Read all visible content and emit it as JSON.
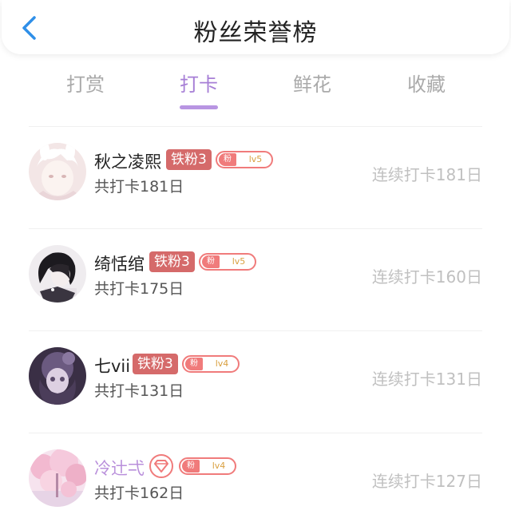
{
  "header": {
    "title": "粉丝荣誉榜",
    "back_icon": "chevron-left-icon"
  },
  "tabs": [
    {
      "label": "打赏",
      "active": false
    },
    {
      "label": "打卡",
      "active": true
    },
    {
      "label": "鲜花",
      "active": false
    },
    {
      "label": "收藏",
      "active": false
    }
  ],
  "colors": {
    "accent": "#a77fd6",
    "iron_tag": "#d56a6a",
    "fan_badge": "#f07b7b",
    "back_icon": "#2f8fe8"
  },
  "rows": [
    {
      "name": "秋之凌熙",
      "tag": "铁粉3",
      "fan_label": "粉",
      "fan_level": "lv5",
      "total": "共打卡181日",
      "streak": "连续打卡181日"
    },
    {
      "name": "绮恬绾",
      "tag": "铁粉3",
      "fan_label": "粉",
      "fan_level": "lv5",
      "total": "共打卡175日",
      "streak": "连续打卡160日"
    },
    {
      "name": "七vii",
      "tag": "铁粉3",
      "fan_label": "粉",
      "fan_level": "lv4",
      "total": "共打卡131日",
      "streak": "连续打卡131日"
    },
    {
      "name": "冷辻弌",
      "tag": "",
      "badge_icon": "diamond-icon",
      "fan_label": "粉",
      "fan_level": "lv4",
      "total": "共打卡162日",
      "streak": "连续打卡127日"
    }
  ]
}
